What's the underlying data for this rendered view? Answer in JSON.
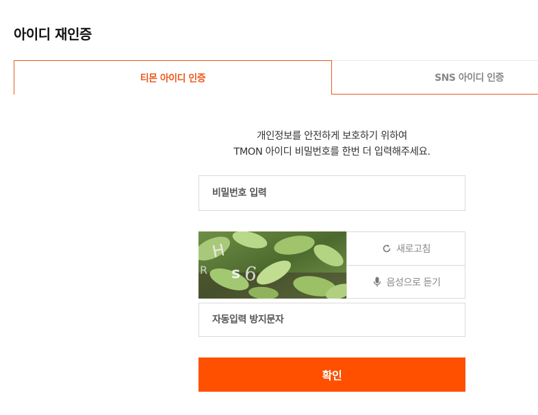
{
  "page": {
    "title": "아이디 재인증"
  },
  "tabs": [
    {
      "label": "티몬 아이디 인증",
      "active": true
    },
    {
      "label": "SNS 아이디 인증",
      "active": false
    }
  ],
  "description": {
    "line1": "개인정보를 안전하게 보호하기 위하여",
    "line2": "TMON 아이디 비밀번호를 한번 더 입력해주세요."
  },
  "password_field": {
    "placeholder": "비밀번호 입력",
    "value": ""
  },
  "captcha": {
    "refresh_label": "새로고침",
    "refresh_icon": "refresh-icon",
    "audio_label": "음성으로 듣기",
    "audio_icon": "microphone-icon"
  },
  "captcha_field": {
    "placeholder": "자동입력 방지문자",
    "value": ""
  },
  "confirm_button": {
    "label": "확인"
  },
  "colors": {
    "accent": "#ff5000",
    "tab_active_text": "#ee5a1f",
    "border": "#d9d9d9"
  }
}
